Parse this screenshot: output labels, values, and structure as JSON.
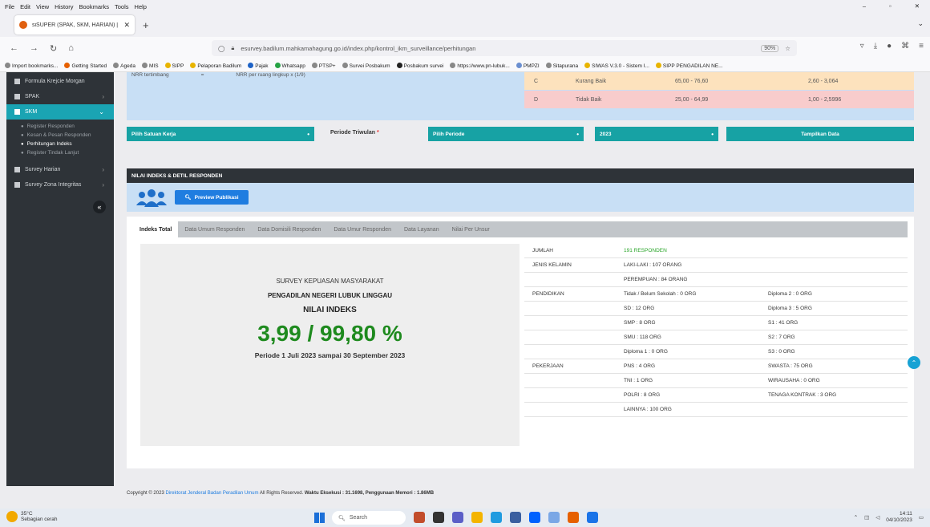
{
  "browser": {
    "menu": [
      "File",
      "Edit",
      "View",
      "History",
      "Bookmarks",
      "Tools",
      "Help"
    ],
    "tab_title": "siSUPER (SPAK, SKM, HARIAN) | Dire",
    "url": "esurvey.badilum.mahkamahagung.go.id/index.php/kontrol_ikm_surveillance/perhitungan",
    "zoom": "90%",
    "bookmarks": [
      "Import bookmarks...",
      "Getting Started",
      "Ageda",
      "MIS",
      "SIPP",
      "Pelaporan Badilum",
      "Pajak",
      "Whatsapp",
      "PTSP+",
      "Survei Posbakum",
      "Posbakum survei",
      "https://www.pn-lubuk...",
      "PMPZI",
      "Sitapurana",
      "SIWAS V.3.0 - Sistem I...",
      "SIPP PENGADILAN NE..."
    ]
  },
  "sidebar": {
    "items": [
      {
        "label": "Formula Krejcie Morgan"
      },
      {
        "label": "SPAK"
      },
      {
        "label": "SKM"
      }
    ],
    "sub_items": [
      "Register Responden",
      "Kesan & Pesan Responden",
      "Perhitungan Indeks",
      "Register Tindak Lanjut"
    ],
    "items2": [
      {
        "label": "Survey Harian"
      },
      {
        "label": "Survey Zona Integritas"
      }
    ]
  },
  "info": {
    "left_label": "NRR tertimbang",
    "left_eq": "=",
    "left_value": "NRR per ruang lingkup x (1/9)",
    "grades": [
      {
        "mutu": "C",
        "kinerja": "Kurang Baik",
        "interval": "65,00 - 76,60",
        "nilai": "2,60 - 3,064"
      },
      {
        "mutu": "D",
        "kinerja": "Tidak Baik",
        "interval": "25,00 - 64,99",
        "nilai": "1,00 - 2,5996"
      }
    ]
  },
  "filters": {
    "satker": "Pilih Satuan Kerja",
    "periode_label": "Periode Triwulan",
    "periode_req": "*",
    "periode": "Pilih Periode",
    "tahun": "2023",
    "button": "Tampilkan Data"
  },
  "nilai": {
    "header": "NILAI INDEKS & DETIL RESPONDEN",
    "preview_button": "Preview Publikasi",
    "tabs": [
      "Indeks Total",
      "Data Umum Responden",
      "Data Domisili Responden",
      "Data Umur Responden",
      "Data Layanan",
      "Nilai Per Unsur"
    ]
  },
  "summary": {
    "line1": "SURVEY KEPUASAN MASYARAKAT",
    "line2": "PENGADILAN NEGERI LUBUK LINGGAU",
    "line3": "NILAI INDEKS",
    "value": "3,99 / 99,80 %",
    "periode": "Periode 1 Juli 2023 sampai 30 September 2023"
  },
  "stats": [
    {
      "c1": "JUMLAH",
      "c2": "191 RESPONDEN",
      "c3": ""
    },
    {
      "c1": "JENIS KELAMIN",
      "c2": "LAKI-LAKI : 107 ORANG",
      "c3": ""
    },
    {
      "c1": "",
      "c2": "PEREMPUAN : 84 ORANG",
      "c3": ""
    },
    {
      "c1": "PENDIDIKAN",
      "c2": "Tidak / Belum Sekolah : 0 ORG",
      "c3": "Diploma 2 : 0 ORG"
    },
    {
      "c1": "",
      "c2": "SD : 12 ORG",
      "c3": "Diploma 3 : 5 ORG"
    },
    {
      "c1": "",
      "c2": "SMP : 8 ORG",
      "c3": "S1 : 41 ORG"
    },
    {
      "c1": "",
      "c2": "SMU : 118 ORG",
      "c3": "S2 : 7 ORG"
    },
    {
      "c1": "",
      "c2": "Diploma 1 : 0 ORG",
      "c3": "S3 : 0 ORG"
    },
    {
      "c1": "PEKERJAAN",
      "c2": "PNS : 4 ORG",
      "c3": "SWASTA : 75 ORG"
    },
    {
      "c1": "",
      "c2": "TNI : 1 ORG",
      "c3": "WIRAUSAHA : 0 ORG"
    },
    {
      "c1": "",
      "c2": "POLRI : 8 ORG",
      "c3": "TENAGA KONTRAK : 3 ORG"
    },
    {
      "c1": "",
      "c2": "LAINNYA : 100 ORG",
      "c3": ""
    }
  ],
  "footer": {
    "prefix": "Copyright © 2023",
    "link": "Direktorat Jenderal Badan Peradilan Umum",
    "middle": "All Rights Reserved.",
    "exec_label": "Waktu Eksekusi : 31.1698,",
    "mem_label": "Penggunaan Memori : 1.86MB"
  },
  "taskbar": {
    "temp": "35°C",
    "weather": "Sebagian cerah",
    "search": "Search",
    "time": "14:11",
    "date": "04/10/2023"
  }
}
